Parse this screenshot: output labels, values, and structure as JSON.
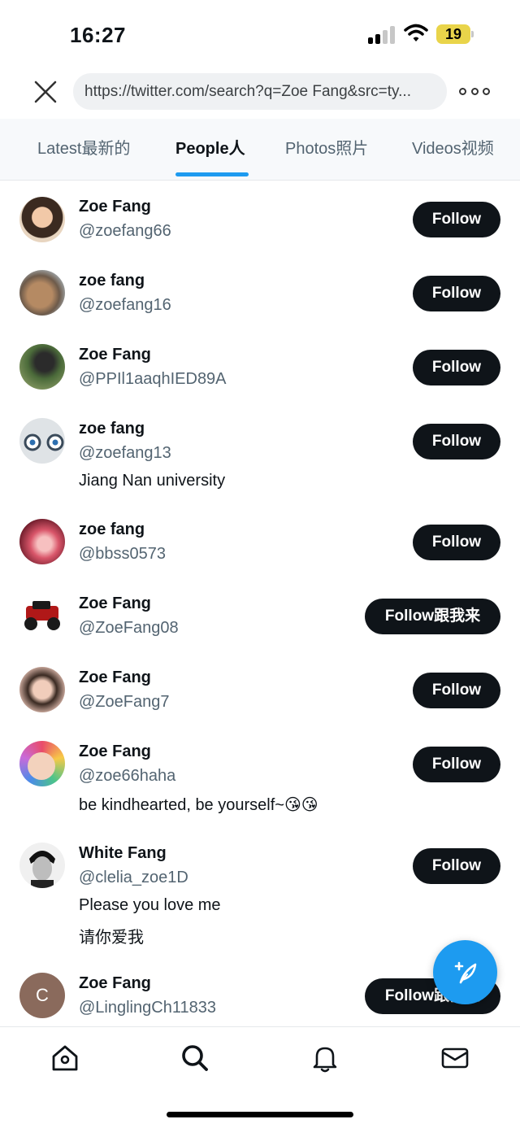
{
  "status": {
    "time": "16:27",
    "battery": "19"
  },
  "browser": {
    "url": "https://twitter.com/search?q=Zoe Fang&src=ty...",
    "close_icon": "close-icon",
    "more_icon": "more-dots-icon"
  },
  "tabs": [
    {
      "label": "Latest最新的",
      "active": false
    },
    {
      "label": "People人",
      "active": true
    },
    {
      "label": "Photos照片",
      "active": false
    },
    {
      "label": "Videos视频",
      "active": false
    }
  ],
  "people": [
    {
      "name": "Zoe Fang",
      "handle": "@zoefang66",
      "bio": [],
      "button": "Follow"
    },
    {
      "name": "zoe fang",
      "handle": "@zoefang16",
      "bio": [],
      "button": "Follow"
    },
    {
      "name": "Zoe Fang",
      "handle": "@PPIl1aaqhIED89A",
      "bio": [],
      "button": "Follow"
    },
    {
      "name": "zoe fang",
      "handle": "@zoefang13",
      "bio": [
        "Jiang Nan university"
      ],
      "button": "Follow"
    },
    {
      "name": "zoe fang",
      "handle": "@bbss0573",
      "bio": [],
      "button": "Follow"
    },
    {
      "name": "Zoe Fang",
      "handle": "@ZoeFang08",
      "bio": [],
      "button": "Follow跟我来"
    },
    {
      "name": "Zoe Fang",
      "handle": "@ZoeFang7",
      "bio": [],
      "button": "Follow"
    },
    {
      "name": "Zoe Fang",
      "handle": "@zoe66haha",
      "bio": [
        "be kindhearted, be yourself~😘😘"
      ],
      "button": "Follow"
    },
    {
      "name": "White Fang",
      "handle": "@clelia_zoe1D",
      "bio": [
        "Please you love me",
        "请你爱我"
      ],
      "button": "Follow"
    },
    {
      "name": "Zoe Fang",
      "handle": "@LinglingCh11833",
      "bio": [],
      "button": "Follow跟我来",
      "avatar_letter": "C"
    }
  ],
  "colors": {
    "accent": "#1d9bf0",
    "button_bg": "#0f1419",
    "secondary_text": "#536471"
  },
  "nav": [
    "home-icon",
    "search-icon",
    "notifications-bell-icon",
    "messages-envelope-icon"
  ],
  "fab_icon": "compose-feather-icon"
}
